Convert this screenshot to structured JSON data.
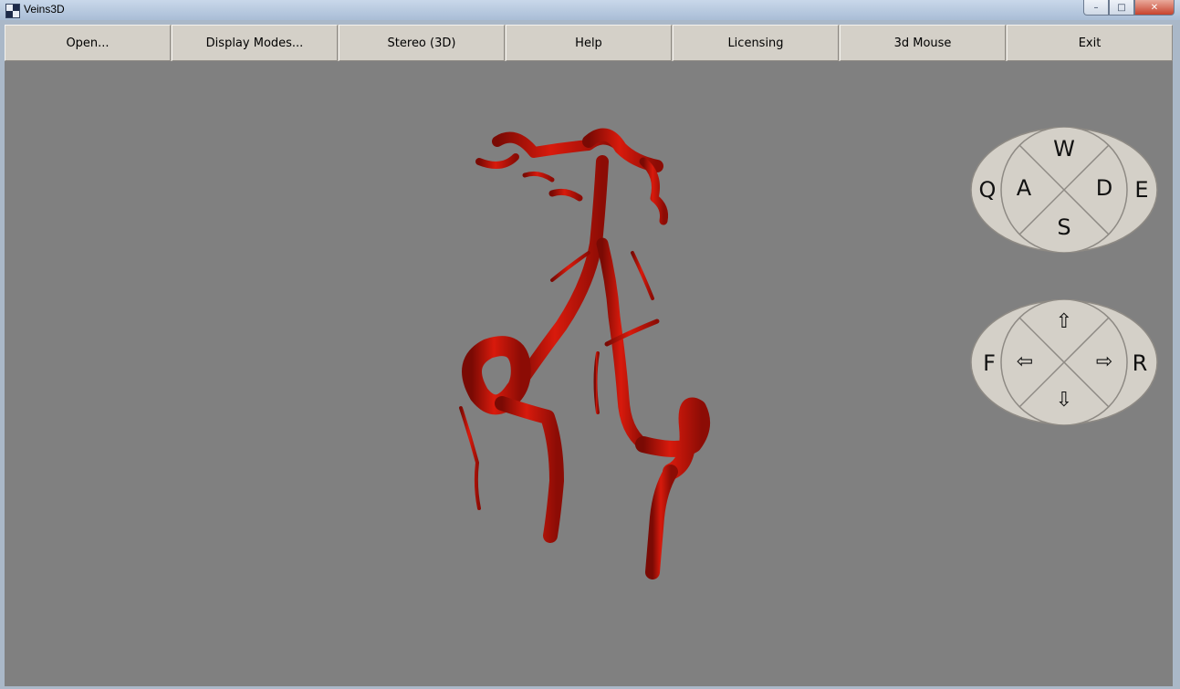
{
  "window": {
    "title": "Veins3D",
    "min_glyph": "–",
    "max_glyph": "□",
    "close_glyph": "✕"
  },
  "menu": [
    {
      "label": "Open..."
    },
    {
      "label": "Display Modes..."
    },
    {
      "label": "Stereo (3D)"
    },
    {
      "label": "Help"
    },
    {
      "label": "Licensing"
    },
    {
      "label": "3d Mouse"
    },
    {
      "label": "Exit"
    }
  ],
  "rotation_pad": {
    "up": "W",
    "left": "A",
    "right": "D",
    "down": "S",
    "outer_left": "Q",
    "outer_right": "E"
  },
  "move_pad": {
    "up": "⇧",
    "left": "⇦",
    "right": "⇨",
    "down": "⇩",
    "outer_left": "F",
    "outer_right": "R"
  },
  "colors": {
    "viewport_bg": "#808080",
    "vessel": "#c81006",
    "pad_fill": "#d4d0c8"
  }
}
